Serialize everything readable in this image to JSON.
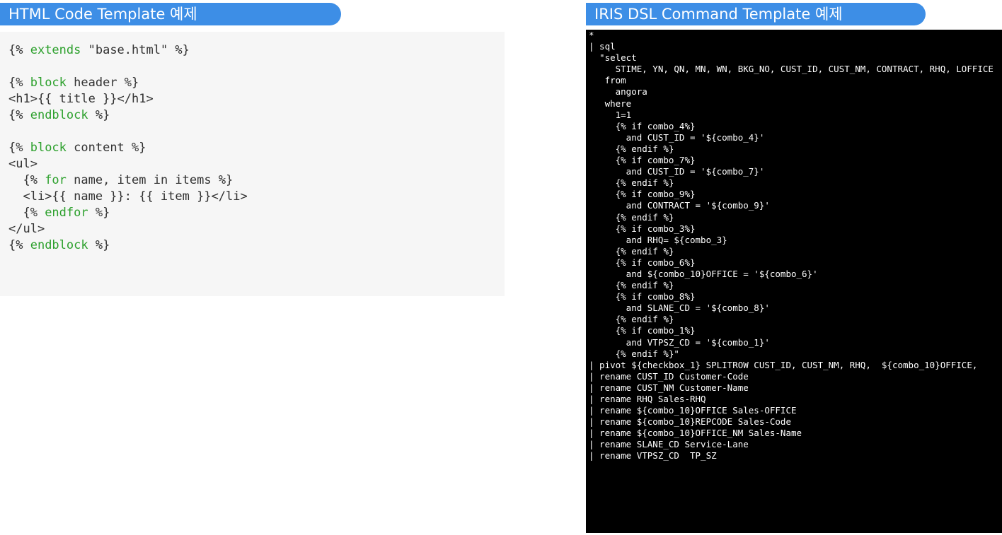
{
  "left_panel": {
    "title": "HTML Code Template 예제",
    "lines": [
      [
        {
          "t": "{% "
        },
        {
          "t": "extends",
          "k": 1
        },
        {
          "t": " \"base.html\" %}"
        }
      ],
      [],
      [
        {
          "t": "{% "
        },
        {
          "t": "block",
          "k": 1
        },
        {
          "t": " header %}"
        }
      ],
      [
        {
          "t": "<h1>{{ title }}</h1>"
        }
      ],
      [
        {
          "t": "{% "
        },
        {
          "t": "endblock",
          "k": 1
        },
        {
          "t": " %}"
        }
      ],
      [],
      [
        {
          "t": "{% "
        },
        {
          "t": "block",
          "k": 1
        },
        {
          "t": " content %}"
        }
      ],
      [
        {
          "t": "<ul>"
        }
      ],
      [
        {
          "t": "  {% "
        },
        {
          "t": "for",
          "k": 1
        },
        {
          "t": " name, item in items %}"
        }
      ],
      [
        {
          "t": "  <li>{{ name }}: {{ item }}</li>"
        }
      ],
      [
        {
          "t": "  {% "
        },
        {
          "t": "endfor",
          "k": 1
        },
        {
          "t": " %}"
        }
      ],
      [
        {
          "t": "</ul>"
        }
      ],
      [
        {
          "t": "{% "
        },
        {
          "t": "endblock",
          "k": 1
        },
        {
          "t": " %}"
        }
      ]
    ]
  },
  "right_panel": {
    "title": "IRIS DSL Command Template 예제",
    "lines": [
      "*",
      "| sql",
      "  \"select",
      "     STIME, YN, QN, MN, WN, BKG_NO, CUST_ID, CUST_NM, CONTRACT, RHQ, LOFFICE",
      "   from",
      "     angora",
      "   where",
      "     1=1",
      "     {% if combo_4%}",
      "       and CUST_ID = '${combo_4}'",
      "     {% endif %}",
      "     {% if combo_7%}",
      "       and CUST_ID = '${combo_7}'",
      "     {% endif %}",
      "     {% if combo_9%}",
      "       and CONTRACT = '${combo_9}'",
      "     {% endif %}",
      "     {% if combo_3%}",
      "       and RHQ= ${combo_3}",
      "     {% endif %}",
      "     {% if combo_6%}",
      "       and ${combo_10}OFFICE = '${combo_6}'",
      "     {% endif %}",
      "     {% if combo_8%}",
      "       and SLANE_CD = '${combo_8}'",
      "     {% endif %}",
      "     {% if combo_1%}",
      "       and VTPSZ_CD = '${combo_1}'",
      "     {% endif %}\"",
      "| pivot ${checkbox_1} SPLITROW CUST_ID, CUST_NM, RHQ,  ${combo_10}OFFICE,",
      "| rename CUST_ID Customer-Code",
      "| rename CUST_NM Customer-Name",
      "| rename RHQ Sales-RHQ",
      "| rename ${combo_10}OFFICE Sales-OFFICE",
      "| rename ${combo_10}REPCODE Sales-Code",
      "| rename ${combo_10}OFFICE_NM Sales-Name",
      "| rename SLANE_CD Service-Lane",
      "| rename VTPSZ_CD  TP_SZ"
    ]
  }
}
